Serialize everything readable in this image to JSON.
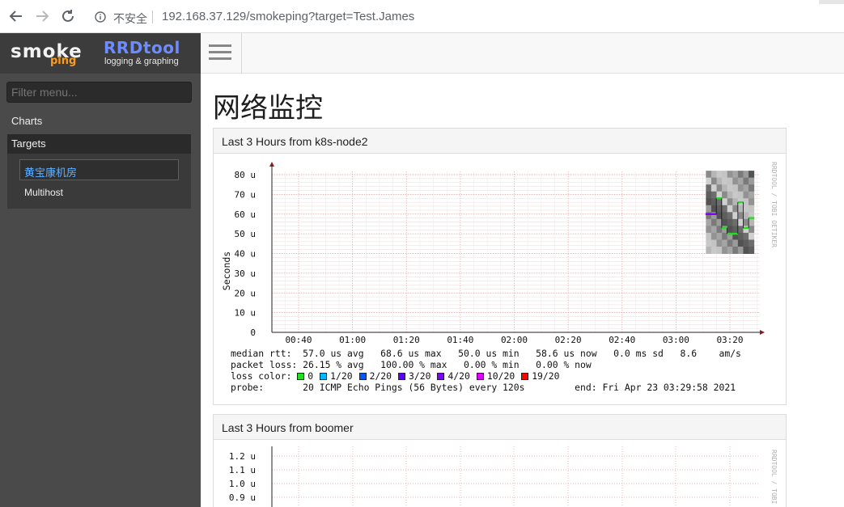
{
  "browser": {
    "insecure_label": "不安全",
    "url_host": "192.168.37.129",
    "url_path": "/smokeping?target=Test.James",
    "back_icon": "back-arrow-icon",
    "forward_icon": "forward-arrow-icon",
    "reload_icon": "reload-icon",
    "info_icon": "info-icon"
  },
  "header": {
    "logo_smoke": "smoke",
    "logo_ping": "ping",
    "rrd_title": "RRDtool",
    "rrd_subtitle": "logging & graphing",
    "menu_icon": "hamburger-menu-icon"
  },
  "sidebar": {
    "filter_placeholder": "Filter menu...",
    "charts_label": "Charts",
    "targets_label": "Targets",
    "items": [
      {
        "label": "黄宝康机房",
        "active": true
      },
      {
        "label": "Multihost",
        "active": false
      }
    ]
  },
  "main": {
    "title": "网络监控",
    "panels": [
      {
        "heading": "Last 3 Hours from k8s-node2",
        "y_axis_label": "Seconds",
        "watermark": "RRDTOOL / TOBI OETIKER",
        "y_ticks": [
          "80 u",
          "70 u",
          "60 u",
          "50 u",
          "40 u",
          "30 u",
          "20 u",
          "10 u",
          "0"
        ],
        "x_ticks": [
          "00:40",
          "01:00",
          "01:20",
          "01:40",
          "02:00",
          "02:20",
          "02:40",
          "03:00",
          "03:20"
        ],
        "legend": {
          "median": "median rtt:  57.0 us avg   68.6 us max   50.0 us min   58.6 us now   0.0 ms sd   8.6    am/s",
          "loss": "packet loss: 26.15 % avg   100.00 % max   0.00 % min   0.00 % now",
          "loss_color_label": "loss color:",
          "loss_colors": [
            {
              "label": "0",
              "color": "#22dd22"
            },
            {
              "label": "1/20",
              "color": "#00b8ff"
            },
            {
              "label": "2/20",
              "color": "#0059ff"
            },
            {
              "label": "3/20",
              "color": "#5e00ff"
            },
            {
              "label": "4/20",
              "color": "#7e00ff"
            },
            {
              "label": "10/20",
              "color": "#dd00ff"
            },
            {
              "label": "19/20",
              "color": "#ff0000"
            }
          ],
          "probe": "probe:       20 ICMP Echo Pings (56 Bytes) every 120s         end: Fri Apr 23 03:29:58 2021"
        }
      },
      {
        "heading": "Last 3 Hours from boomer",
        "watermark": "RRDTOOL / TOBI",
        "y_ticks": [
          "1.2 u",
          "1.1 u",
          "1.0 u",
          "0.9 u"
        ]
      }
    ]
  },
  "chart_data": {
    "type": "line",
    "ylabel": "Seconds",
    "x_ticks": [
      "00:40",
      "01:00",
      "01:20",
      "01:40",
      "02:00",
      "02:20",
      "02:40",
      "03:00",
      "03:20"
    ],
    "y_unit": "u",
    "ylim": [
      0,
      80
    ],
    "series": [
      {
        "name": "median rtt",
        "x": [
          "03:12",
          "03:14",
          "03:16",
          "03:18",
          "03:20",
          "03:22",
          "03:24",
          "03:26",
          "03:28"
        ],
        "y": [
          60,
          60,
          68,
          53,
          50,
          50,
          66,
          53,
          58
        ]
      }
    ]
  }
}
